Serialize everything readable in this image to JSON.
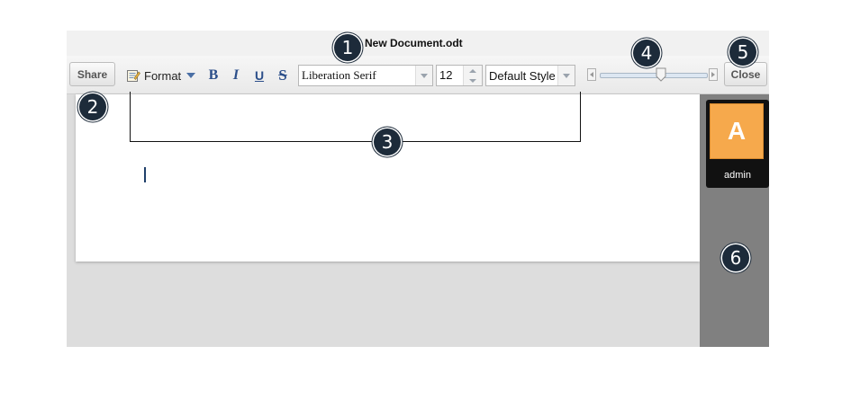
{
  "window": {
    "title": "New Document.odt"
  },
  "toolbar": {
    "share_label": "Share",
    "format_label": "Format",
    "bold_label": "B",
    "italic_label": "I",
    "underline_label": "U",
    "strike_label": "S",
    "font_family": "Liberation Serif",
    "font_size": "12",
    "paragraph_style": "Default Style",
    "close_label": "Close"
  },
  "sidebar": {
    "member": {
      "initial": "A",
      "name": "admin",
      "avatar_color": "#f6a94c"
    }
  },
  "callouts": [
    "1",
    "2",
    "3",
    "4",
    "5",
    "6"
  ],
  "colors": {
    "callout_bg": "#1d2b3a",
    "format_icon_accent": "#2c4f8a",
    "sidebar_bg": "#808080",
    "canvas_bg": "#dddddd"
  }
}
